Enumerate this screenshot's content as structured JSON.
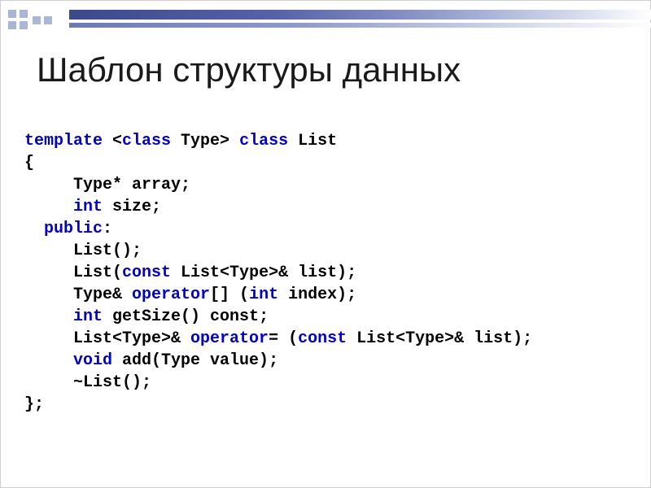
{
  "title": "Шаблон структуры данных",
  "code": {
    "l1_template": "template",
    "l1_lt": " <",
    "l1_class1": "class",
    "l1_mid": " Type> ",
    "l1_class2": "class",
    "l1_end": " List",
    "l2": "{",
    "l3a": "     Type* array;",
    "l4_pad": "     ",
    "l4_int": "int",
    "l4_rest": " size;",
    "l5_pad": "  ",
    "l5_public": "public",
    "l5_rest": ":",
    "l6": "     List();",
    "l7_pad": "     List(",
    "l7_const": "const",
    "l7_rest": " List<Type>& list);",
    "l8_pad": "     Type& ",
    "l8_op": "operator",
    "l8_mid": "[] (",
    "l8_int": "int",
    "l8_rest": " index);",
    "l9_pad": "     ",
    "l9_int": "int",
    "l9_rest": " getSize() const;",
    "l10_pad": "     List<Type>& ",
    "l10_op": "operator",
    "l10_mid": "= (",
    "l10_const": "const",
    "l10_rest": " List<Type>& list);",
    "l11_pad": "     ",
    "l11_void": "void",
    "l11_rest": " add(Type value);",
    "l12": "     ~List();",
    "l13": "};"
  }
}
